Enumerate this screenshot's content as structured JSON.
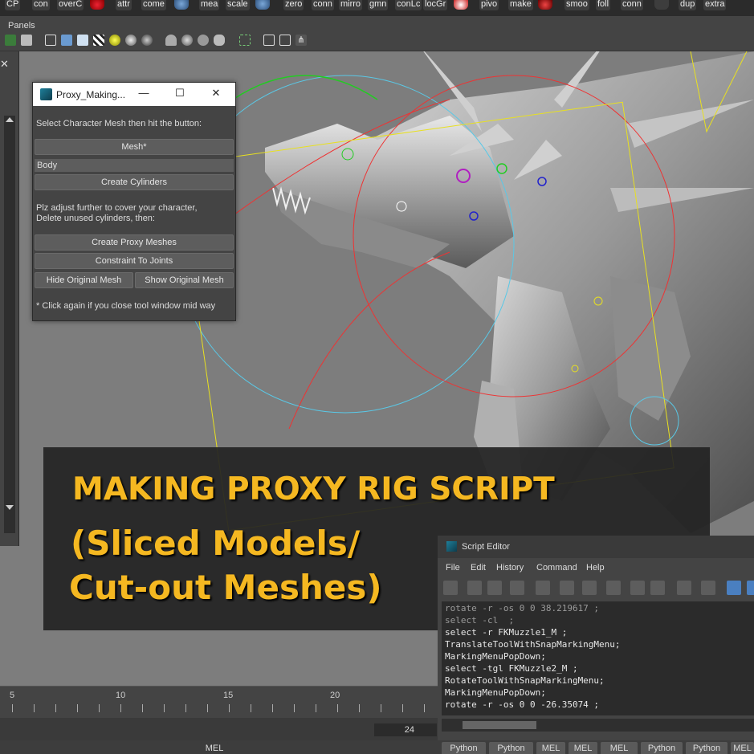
{
  "shelf": {
    "buttons": [
      "CP",
      "con",
      "overC",
      "attr",
      "come",
      "mea",
      "scale",
      "zero",
      "conn",
      "mirro",
      "gmn",
      "conLc",
      "locGr",
      "pivo",
      "make",
      "smoo",
      "foll",
      "conn",
      "dup",
      "extra"
    ]
  },
  "panel_bar": {
    "menu_label": "Panels"
  },
  "proxy_window": {
    "title": "Proxy_Making...",
    "minimize_glyph": "—",
    "maximize_glyph": "☐",
    "close_glyph": "✕",
    "instruction": "Select Character Mesh then hit the button:",
    "mesh_button": "Mesh*",
    "mesh_field_value": "Body",
    "create_cylinders_button": "Create Cylinders",
    "adjust_text_line1": "Plz adjust further to cover your character,",
    "adjust_text_line2": "Delete unused cylinders, then:",
    "create_proxy_button": "Create Proxy Meshes",
    "constraint_button": "Constraint To Joints",
    "hide_button": "Hide Original Mesh",
    "show_button": "Show Original Mesh",
    "note": "* Click again if you close tool window mid way"
  },
  "banner": {
    "line1": "MAKING PROXY RIG SCRIPT",
    "line2": "(Sliced Models/",
    "line3": "Cut-out Meshes)",
    "color": "#f5b821"
  },
  "script_editor": {
    "title": "Script Editor",
    "menu": [
      "File",
      "Edit",
      "History",
      "Command",
      "Help"
    ],
    "lines": [
      "rotate -r -os 0 0 38.219617 ;",
      "select -cl  ;",
      "select -r FKMuzzle1_M ;",
      "TranslateToolWithSnapMarkingMenu;",
      "MarkingMenuPopDown;",
      "select -tgl FKMuzzle2_M ;",
      "RotateToolWithSnapMarkingMenu;",
      "MarkingMenuPopDown;",
      "rotate -r -os 0 0 -26.35074 ;"
    ]
  },
  "timeline": {
    "ticks": [
      "5",
      "10",
      "15",
      "20"
    ],
    "tick_labels": [
      "5",
      "",
      "",
      "",
      "",
      "10",
      "",
      "",
      "",
      "",
      "15",
      "",
      "",
      "",
      "",
      "20",
      "",
      "",
      "",
      "",
      "24"
    ],
    "end_frame": "24"
  },
  "bottom_tabs": [
    "MEL",
    "Python",
    "Python",
    "MEL",
    "MEL",
    "MEL",
    "Python",
    "Python",
    "MEL"
  ]
}
